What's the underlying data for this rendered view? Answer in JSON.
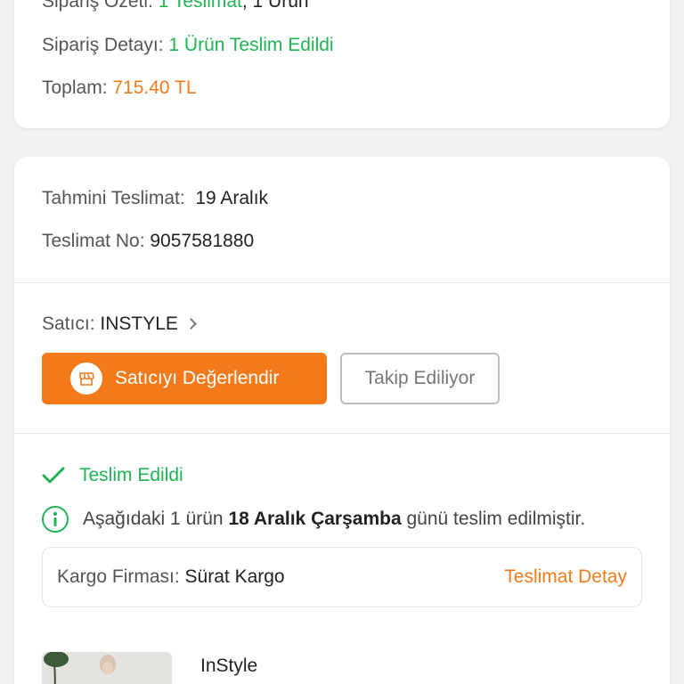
{
  "summary": {
    "order_summary_label": "Sipariş Özeti:",
    "order_summary_value": "1 Teslimat",
    "order_summary_rest": ", 1 Ürün",
    "order_detail_label": "Sipariş Detayı:",
    "order_detail_value": "1 Ürün Teslim Edildi",
    "total_label": "Toplam:",
    "total_value": "715.40 TL"
  },
  "delivery": {
    "estimated_label": "Tahmini Teslimat:",
    "estimated_value": "19 Aralık",
    "number_label": "Teslimat No:",
    "number_value": "9057581880"
  },
  "seller": {
    "label": "Satıcı:",
    "name": "INSTYLE",
    "rate_button": "Satıcıyı Değerlendir",
    "follow_button": "Takip Ediliyor"
  },
  "status": {
    "text": "Teslim Edildi",
    "info_prefix": "Aşağıdaki 1 ürün",
    "info_date": "18 Aralık Çarşamba",
    "info_suffix": "günü teslim edilmiştir."
  },
  "cargo": {
    "label": "Kargo Firması:",
    "company": "Sürat Kargo",
    "detail_link": "Teslimat Detay"
  },
  "product": {
    "brand": "InStyle"
  },
  "colors": {
    "accent_orange": "#f27a1a",
    "success_green": "#1fb355"
  }
}
